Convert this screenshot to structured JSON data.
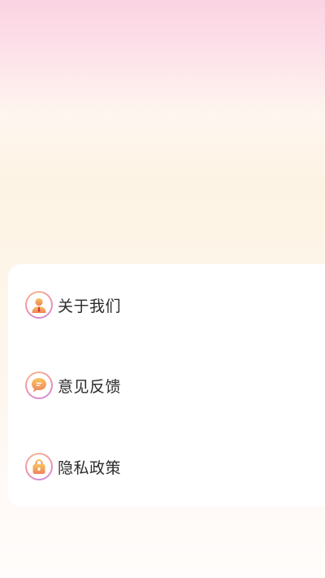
{
  "menu": {
    "items": [
      {
        "label": "关于我们",
        "icon": "person-icon"
      },
      {
        "label": "意见反馈",
        "icon": "chat-bubble-icon"
      },
      {
        "label": "隐私政策",
        "icon": "lock-bag-icon"
      }
    ]
  },
  "colors": {
    "icon_fill_start": "#f8c35a",
    "icon_fill_end": "#f0825e",
    "ring_start": "#f5b88a",
    "ring_end": "#c98fe0",
    "label_text": "#2b2b2b",
    "card_bg": "#ffffff"
  }
}
